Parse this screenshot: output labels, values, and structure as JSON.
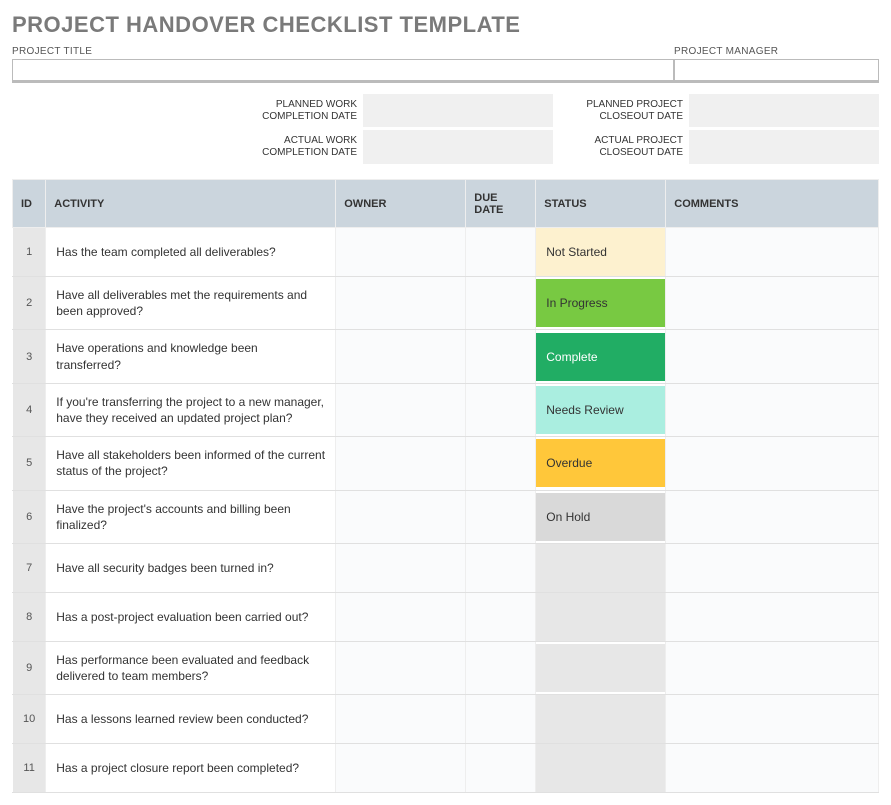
{
  "header": {
    "title": "PROJECT HANDOVER CHECKLIST TEMPLATE"
  },
  "fields": {
    "project_title_label": "PROJECT TITLE",
    "project_title_value": "",
    "project_manager_label": "PROJECT MANAGER",
    "project_manager_value": "",
    "planned_work_label": "PLANNED WORK COMPLETION DATE",
    "planned_work_value": "",
    "actual_work_label": "ACTUAL WORK COMPLETION DATE",
    "actual_work_value": "",
    "planned_closeout_label": "PLANNED PROJECT CLOSEOUT DATE",
    "planned_closeout_value": "",
    "actual_closeout_label": "ACTUAL PROJECT CLOSEOUT DATE",
    "actual_closeout_value": ""
  },
  "table": {
    "headers": {
      "id": "ID",
      "activity": "ACTIVITY",
      "owner": "OWNER",
      "due_date": "DUE DATE",
      "status": "STATUS",
      "comments": "COMMENTS"
    },
    "status_classes": {
      "Not Started": "status-not-started",
      "In Progress": "status-in-progress",
      "Complete": "status-complete",
      "Needs Review": "status-needs-review",
      "Overdue": "status-overdue",
      "On Hold": "status-on-hold"
    },
    "rows": [
      {
        "id": "1",
        "activity": "Has the team completed all deliverables?",
        "owner": "",
        "due": "",
        "status": "Not Started",
        "comments": ""
      },
      {
        "id": "2",
        "activity": "Have all deliverables met the requirements and been approved?",
        "owner": "",
        "due": "",
        "status": "In Progress",
        "comments": ""
      },
      {
        "id": "3",
        "activity": "Have operations and knowledge been transferred?",
        "owner": "",
        "due": "",
        "status": "Complete",
        "comments": ""
      },
      {
        "id": "4",
        "activity": "If you're transferring the project to a new manager, have they received an updated project plan?",
        "owner": "",
        "due": "",
        "status": "Needs Review",
        "comments": ""
      },
      {
        "id": "5",
        "activity": "Have all stakeholders been informed of the current status of the project?",
        "owner": "",
        "due": "",
        "status": "Overdue",
        "comments": ""
      },
      {
        "id": "6",
        "activity": "Have the project's accounts and billing been finalized?",
        "owner": "",
        "due": "",
        "status": "On Hold",
        "comments": ""
      },
      {
        "id": "7",
        "activity": "Have all security badges been turned in?",
        "owner": "",
        "due": "",
        "status": "",
        "comments": ""
      },
      {
        "id": "8",
        "activity": "Has a post-project evaluation been carried out?",
        "owner": "",
        "due": "",
        "status": "",
        "comments": ""
      },
      {
        "id": "9",
        "activity": "Has performance been evaluated and feedback delivered to team members?",
        "owner": "",
        "due": "",
        "status": "",
        "comments": ""
      },
      {
        "id": "10",
        "activity": "Has a lessons learned review been conducted?",
        "owner": "",
        "due": "",
        "status": "",
        "comments": ""
      },
      {
        "id": "11",
        "activity": "Has a project closure report been completed?",
        "owner": "",
        "due": "",
        "status": "",
        "comments": ""
      }
    ]
  }
}
